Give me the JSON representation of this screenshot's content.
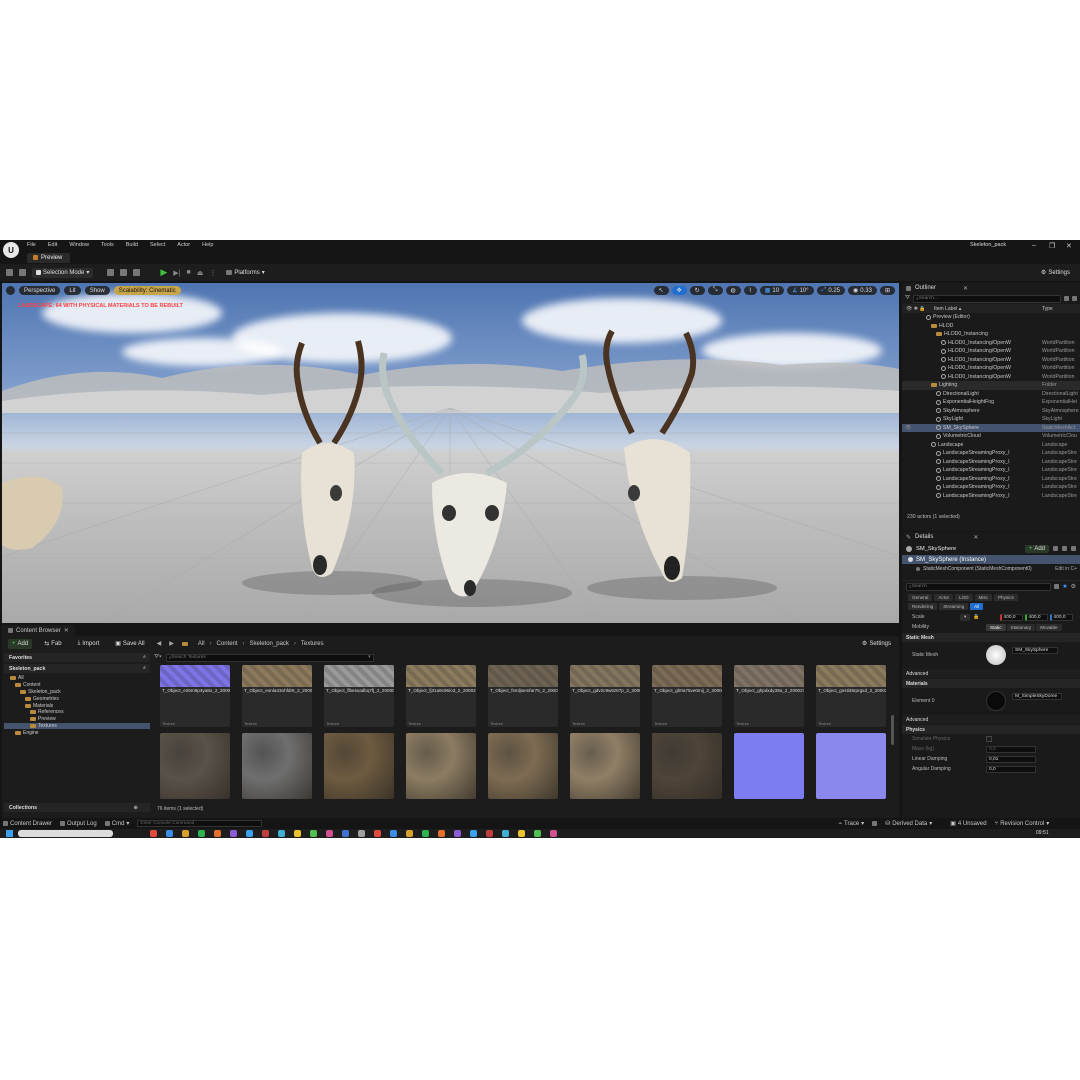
{
  "window": {
    "project_name": "Skeleton_pack"
  },
  "menu": [
    "File",
    "Edit",
    "Window",
    "Tools",
    "Build",
    "Select",
    "Actor",
    "Help"
  ],
  "map_tab": "Preview",
  "toolbar": {
    "selection_mode": "Selection Mode",
    "platforms": "Platforms",
    "settings": "Settings"
  },
  "viewport": {
    "perspective": "Perspective",
    "lit": "Lit",
    "show": "Show",
    "scalability": "Scalability: Cinematic",
    "warning": "LANDSCAPE: 64 WITH PHYSICAL MATERIALS TO BE REBUILT",
    "grid": "10",
    "angle": "10°",
    "scale": "0.25",
    "camera_speed": "0.33"
  },
  "outliner": {
    "title": "Outliner",
    "search_placeholder": "Search...",
    "col_label": "Item Label ▴",
    "col_type": "Type",
    "rows": [
      {
        "label": "Preview (Editor)",
        "type": "",
        "indent": 2,
        "kind": "world"
      },
      {
        "label": "HLOD",
        "type": "",
        "indent": 3,
        "kind": "folder"
      },
      {
        "label": "HLOD0_Instancing",
        "type": "",
        "indent": 4,
        "kind": "folder"
      },
      {
        "label": "HLOD0_Instancing/OpenW",
        "type": "WorldPartition",
        "indent": 5,
        "kind": "actor"
      },
      {
        "label": "HLOD0_Instancing/OpenW",
        "type": "WorldPartition",
        "indent": 5,
        "kind": "actor"
      },
      {
        "label": "HLOD0_Instancing/OpenW",
        "type": "WorldPartition",
        "indent": 5,
        "kind": "actor"
      },
      {
        "label": "HLOD0_Instancing/OpenW",
        "type": "WorldPartition",
        "indent": 5,
        "kind": "actor"
      },
      {
        "label": "HLOD0_Instancing/OpenW",
        "type": "WorldPartition",
        "indent": 5,
        "kind": "actor"
      },
      {
        "label": "Lighting",
        "type": "Folder",
        "indent": 3,
        "kind": "folder",
        "style": "fold"
      },
      {
        "label": "DirectionalLight",
        "type": "DirectionalLight",
        "indent": 4,
        "kind": "actor"
      },
      {
        "label": "ExponentialHeightFog",
        "type": "ExponentialHei",
        "indent": 4,
        "kind": "actor"
      },
      {
        "label": "SkyAtmosphere",
        "type": "SkyAtmosphere",
        "indent": 4,
        "kind": "actor"
      },
      {
        "label": "SkyLight",
        "type": "SkyLight",
        "indent": 4,
        "kind": "actor"
      },
      {
        "label": "SM_SkySphere",
        "type": "StaticMeshAct",
        "indent": 4,
        "kind": "actor",
        "style": "sel"
      },
      {
        "label": "VolumetricCloud",
        "type": "VolumetricClou",
        "indent": 4,
        "kind": "actor"
      },
      {
        "label": "Landscape",
        "type": "Landscape",
        "indent": 3,
        "kind": "actor"
      },
      {
        "label": "LandscapeStreamingProxy_I",
        "type": "LandscapeStre",
        "indent": 4,
        "kind": "actor"
      },
      {
        "label": "LandscapeStreamingProxy_I",
        "type": "LandscapeStre",
        "indent": 4,
        "kind": "actor"
      },
      {
        "label": "LandscapeStreamingProxy_I",
        "type": "LandscapeStre",
        "indent": 4,
        "kind": "actor"
      },
      {
        "label": "LandscapeStreamingProxy_I",
        "type": "LandscapeStre",
        "indent": 4,
        "kind": "actor"
      },
      {
        "label": "LandscapeStreamingProxy_I",
        "type": "LandscapeStre",
        "indent": 4,
        "kind": "actor"
      },
      {
        "label": "LandscapeStreamingProxy_I",
        "type": "LandscapeStre",
        "indent": 4,
        "kind": "actor"
      }
    ],
    "footer": "230 actors (1 selected)"
  },
  "details": {
    "title": "Details",
    "object": "SM_SkySphere",
    "add": "Add",
    "instance": "SM_SkySphere (Instance)",
    "component": "StaticMeshComponent (StaticMeshComponent0)",
    "edit_in": "Edit in C+",
    "search_placeholder": "Search",
    "filters_row1": [
      "General",
      "Actor",
      "LOD",
      "Misc",
      "Physics"
    ],
    "filters_row2": [
      "Rendering",
      "Streaming",
      "All"
    ],
    "active_filter": "All",
    "scale_label": "Scale",
    "scale_values": [
      "400,0",
      "400,0",
      "400,0"
    ],
    "mobility_label": "Mobility",
    "mobility_options": [
      "Static",
      "Stationary",
      "Movable"
    ],
    "sec_static_mesh": "Static Mesh",
    "static_mesh_label": "Static Mesh",
    "static_mesh_value": "SM_SkySphere",
    "sec_advanced": "Advanced",
    "sec_materials": "Materials",
    "element_label": "Element 0",
    "element_value": "M_SimpleSkyDome",
    "sec_advanced2": "Advanced",
    "sec_physics": "Physics",
    "simulate_physics": "Simulate Physics",
    "mass": "Mass (kg)",
    "mass_value": "0,0",
    "linear_damping": "Linear Damping",
    "linear_value": "0,01",
    "angular_damping": "Angular Damping",
    "angular_value": "0,0"
  },
  "content_browser": {
    "tab": "Content Browser",
    "add": "Add",
    "fab": "Fab",
    "import": "Import",
    "save_all": "Save All",
    "breadcrumb": [
      "All",
      "Content",
      "Skeleton_pack",
      "Textures"
    ],
    "settings": "Settings",
    "favorites": "Favorites",
    "project": "Skeleton_pack",
    "search_placeholder": "Search Textures",
    "folders": [
      {
        "name": "All",
        "indent": 0
      },
      {
        "name": "Content",
        "indent": 1
      },
      {
        "name": "Skeleton_pack",
        "indent": 2
      },
      {
        "name": "Geometries",
        "indent": 3
      },
      {
        "name": "Materials",
        "indent": 3
      },
      {
        "name": "References",
        "indent": 4
      },
      {
        "name": "Preview",
        "indent": 4
      },
      {
        "name": "Textures",
        "indent": 4,
        "selected": true
      },
      {
        "name": "Engine",
        "indent": 1
      }
    ],
    "collections": "Collections",
    "item_count": "76 items (1 selected)",
    "type_label": "Texture",
    "top_assets": [
      {
        "name": "T_Object_e26m9p4ya8o_2_200000_Tex",
        "color": "#7e74e8"
      },
      {
        "name": "T_Object_eonla43ohfdr8_2_200027_Tex",
        "color": "#8d7a5c"
      },
      {
        "name": "T_Object_flbesxadbq7fj_2_200000_Tex",
        "color": "#9a9a9a"
      },
      {
        "name": "T_Object_fj31a9c96io3_2_200027_Tex",
        "color": "#8c7b5d"
      },
      {
        "name": "T_Object_fsmljsemfar75_2_200027_Tex",
        "color": "#6e6353"
      },
      {
        "name": "T_Object_gdv2c9w6z87p_2_200027_Tex",
        "color": "#84765e"
      },
      {
        "name": "T_Object_gh0a75ve0mij_2_200000_Tex",
        "color": "#7c6b56"
      },
      {
        "name": "T_Object_ghpdxdy39a_2_200027_Tex",
        "color": "#807264"
      },
      {
        "name": "T_Object_gnsti35rprgxd_2_200027_Tex",
        "color": "#8b7a5c"
      }
    ],
    "bottom_colors": [
      "#5a5248",
      "#6f6f6f",
      "#6e5b40",
      "#8c7c62",
      "#7e6c52",
      "#907f66",
      "#4e4539",
      "#7d7cf0",
      "#8a88ec"
    ]
  },
  "statusbar": {
    "content_drawer": "Content Drawer",
    "output_log": "Output Log",
    "cmd": "Cmd",
    "console_placeholder": "Enter Console Command",
    "trace": "Trace",
    "derived_data": "Derived Data",
    "unsaved": "4 Unsaved",
    "revision_control": "Revision Control"
  },
  "taskbar": {
    "clock": "09:51"
  },
  "colors": {
    "accent": "#1f6fd0",
    "selection": "#44546e",
    "warning": "#ff4040",
    "play": "#40c040"
  }
}
